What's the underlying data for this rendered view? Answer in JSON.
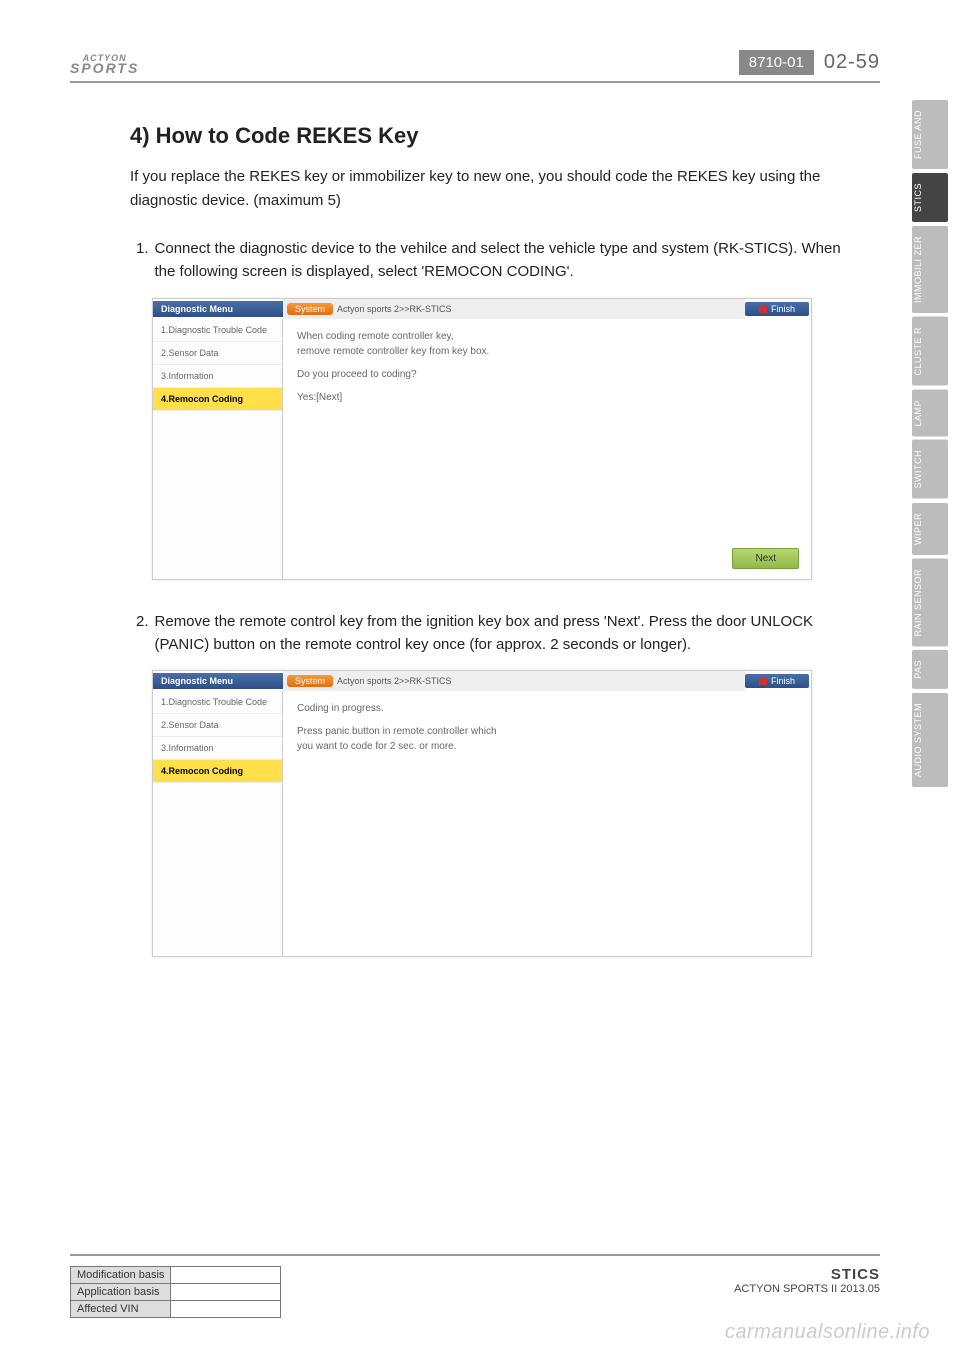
{
  "header": {
    "logo_top": "ACTYON",
    "logo_bottom": "SPORTS",
    "doc_code": "8710-01",
    "page_num": "02-59"
  },
  "section": {
    "title": "4) How to Code REKES Key",
    "intro": "If you replace the REKES key or immobilizer key to new one, you should code the REKES key using the diagnostic device. (maximum 5)"
  },
  "steps": [
    {
      "num": "1.",
      "text": "Connect the diagnostic device to the vehilce and select the vehicle type and system (RK-STICS). When the following screen is displayed, select 'REMOCON CODING'."
    },
    {
      "num": "2.",
      "text": "Remove the remote control key from the ignition key box and press 'Next'. Press the door UNLOCK (PANIC) button on the remote control key once (for approx. 2 seconds or longer)."
    }
  ],
  "diag": {
    "menu_title": "Diagnostic Menu",
    "system_pill": "System",
    "breadcrumb": "Actyon sports 2>>RK-STICS",
    "finish": "Finish",
    "menu_items": [
      "1.Diagnostic Trouble Code",
      "2.Sensor Data",
      "3.Information",
      "4.Remocon Coding"
    ],
    "screen1": {
      "line1": "When coding remote controller key,",
      "line2": "remove remote controller key from key box.",
      "line3": "Do you proceed to coding?",
      "line4": "Yes:[Next]",
      "next": "Next"
    },
    "screen2": {
      "line1": "Coding in progress.",
      "line2": "Press panic button in remote controller which",
      "line3": "you want to code for 2 sec. or more."
    }
  },
  "footer": {
    "rows": [
      "Modification basis",
      "Application basis",
      "Affected VIN"
    ],
    "category": "STICS",
    "model": "ACTYON SPORTS II 2013.05"
  },
  "side_tabs": [
    {
      "label": "FUSE AND",
      "active": false
    },
    {
      "label": "STICS",
      "active": true
    },
    {
      "label": "IMMOBILI ZER",
      "active": false
    },
    {
      "label": "CLUSTE R",
      "active": false
    },
    {
      "label": "LAMP",
      "active": false
    },
    {
      "label": "SWITCH",
      "active": false
    },
    {
      "label": "WIPER",
      "active": false
    },
    {
      "label": "RAIN SENSOR",
      "active": false
    },
    {
      "label": "PAS",
      "active": false
    },
    {
      "label": "AUDIO SYSTEM",
      "active": false
    }
  ],
  "watermark": "carmanualsonline.info"
}
